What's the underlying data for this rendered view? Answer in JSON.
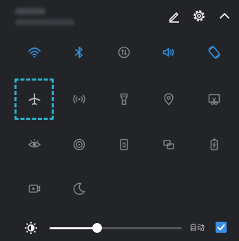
{
  "header": {
    "status_title": "",
    "status_subtitle": "",
    "edit_icon": "edit-pencil-icon",
    "settings_icon": "gear-icon",
    "collapse_icon": "chevron-up-icon"
  },
  "colors": {
    "panel_bg": "#232428",
    "active": "#2f8fd8",
    "inactive": "#7f8187",
    "selection": "#2bb3cf",
    "checkbox": "#3a8fe6"
  },
  "toggles": [
    {
      "id": "wifi",
      "icon": "wifi-icon",
      "active": true
    },
    {
      "id": "bluetooth",
      "icon": "bluetooth-icon",
      "active": true
    },
    {
      "id": "mobile-data",
      "icon": "mobile-data-icon",
      "active": false
    },
    {
      "id": "sound",
      "icon": "sound-icon",
      "active": true
    },
    {
      "id": "auto-rotate",
      "icon": "auto-rotate-icon",
      "active": true
    },
    {
      "id": "airplane-mode",
      "icon": "airplane-icon",
      "active": false,
      "highlighted": true
    },
    {
      "id": "hotspot",
      "icon": "hotspot-icon",
      "active": false
    },
    {
      "id": "flashlight",
      "icon": "flashlight-icon",
      "active": false
    },
    {
      "id": "location",
      "icon": "location-pin-icon",
      "active": false
    },
    {
      "id": "screenshot",
      "icon": "screenshot-icon",
      "active": false
    },
    {
      "id": "eye-comfort",
      "icon": "eye-icon",
      "active": false
    },
    {
      "id": "nfc",
      "icon": "nfc-icon",
      "active": false
    },
    {
      "id": "screen-share",
      "icon": "screen-share-icon",
      "active": false
    },
    {
      "id": "multi-screen",
      "icon": "multi-screen-icon",
      "active": false
    },
    {
      "id": "battery-saver",
      "icon": "battery-icon",
      "active": false
    },
    {
      "id": "screen-record",
      "icon": "screen-record-icon",
      "active": false
    },
    {
      "id": "do-not-disturb",
      "icon": "moon-icon",
      "active": false
    }
  ],
  "brightness": {
    "icon": "brightness-icon",
    "level": 0.36,
    "auto_label": "自动",
    "auto_checked": true
  }
}
